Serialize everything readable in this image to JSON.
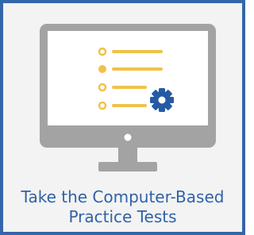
{
  "tile": {
    "caption_line1": "Take the Computer-Based",
    "caption_line2": "Practice Tests",
    "link_color": "#2f62a8",
    "border_color": "#3566a8"
  },
  "icon": {
    "name": "computer-test-icon",
    "monitor_color": "#a3a3a3",
    "screen_color": "#ffffff",
    "bullet_color": "#f0c24a",
    "gear_color": "#265aa5",
    "list_items": 4,
    "selected_item": 2
  }
}
